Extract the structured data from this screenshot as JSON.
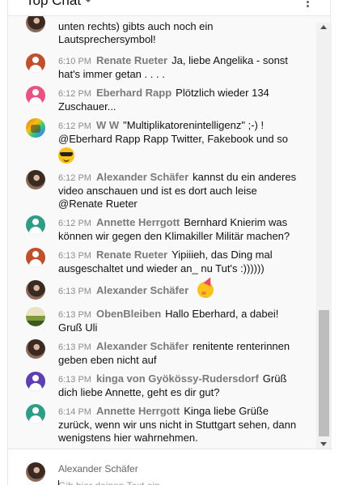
{
  "header": {
    "title": "Top Chat",
    "dropdown_icon": "chevron-down-icon",
    "menu_icon": "more-vert-icon"
  },
  "partial_message": {
    "line1": "unten rechts) gibts auch noch ein",
    "line2": "Lautsprechersymbol!"
  },
  "messages": [
    {
      "time": "6:10 PM",
      "author": "Renate Rueter",
      "text": "Ja, liebe Angelika - sonst hat's immer getan . . . ."
    },
    {
      "time": "6:12 PM",
      "author": "Eberhard Rapp",
      "text": "Plötzlich wieder 134 Zuschauer..."
    },
    {
      "time": "6:12 PM",
      "author": "W W",
      "text": "\"Multiplikatorenintelligenz\" ;-) ! @Eberhard Rapp Rapp Twitter, Fakebook und so"
    },
    {
      "time": "6:12 PM",
      "author": "Alexander Schäfer",
      "text": "kannst du ein anderes video anschauen und ist es dort auch leise @Renate Rueter"
    },
    {
      "time": "6:12 PM",
      "author": "Annette Herrgott",
      "text": "Bernhard Knierim was können wir gegen den Klimakiller Militär machen?"
    },
    {
      "time": "6:13 PM",
      "author": "Renate Rueter",
      "text": "Yipiiieh, das Ding mal ausgeschaltet und wieder an_ nu Tut's :))))))"
    },
    {
      "time": "6:13 PM",
      "author": "Alexander Schäfer",
      "text": ""
    },
    {
      "time": "6:13 PM",
      "author": "ObenBleiben",
      "text": "Hallo Eberhard, a dabei! Gruß Uli"
    },
    {
      "time": "6:13 PM",
      "author": "Alexander Schäfer",
      "text": "renitente renterinnen geben eben nicht auf"
    },
    {
      "time": "6:13 PM",
      "author": "kinga von Gyökössy-Rudersdorf",
      "text": "Grüß dich liebe Annette, geht es dir gut?"
    },
    {
      "time": "6:14 PM",
      "author": "Annette Herrgott",
      "text": "Kinga liebe Grüße zurück, wenn wir uns nicht in Stuttgart sehen, dann wenigstens hier wahrnehmen."
    }
  ],
  "emojis": {
    "cool": "smiling-face-with-sunglasses",
    "party": "partying-face"
  },
  "composer": {
    "name": "Alexander Schäfer",
    "placeholder": "Gib hier deinen Text ein..."
  },
  "colors": {
    "renate": "#c0502b",
    "eberhard": "#e8547f",
    "annette": "#2f9c88",
    "kinga": "#5e3fb0"
  }
}
